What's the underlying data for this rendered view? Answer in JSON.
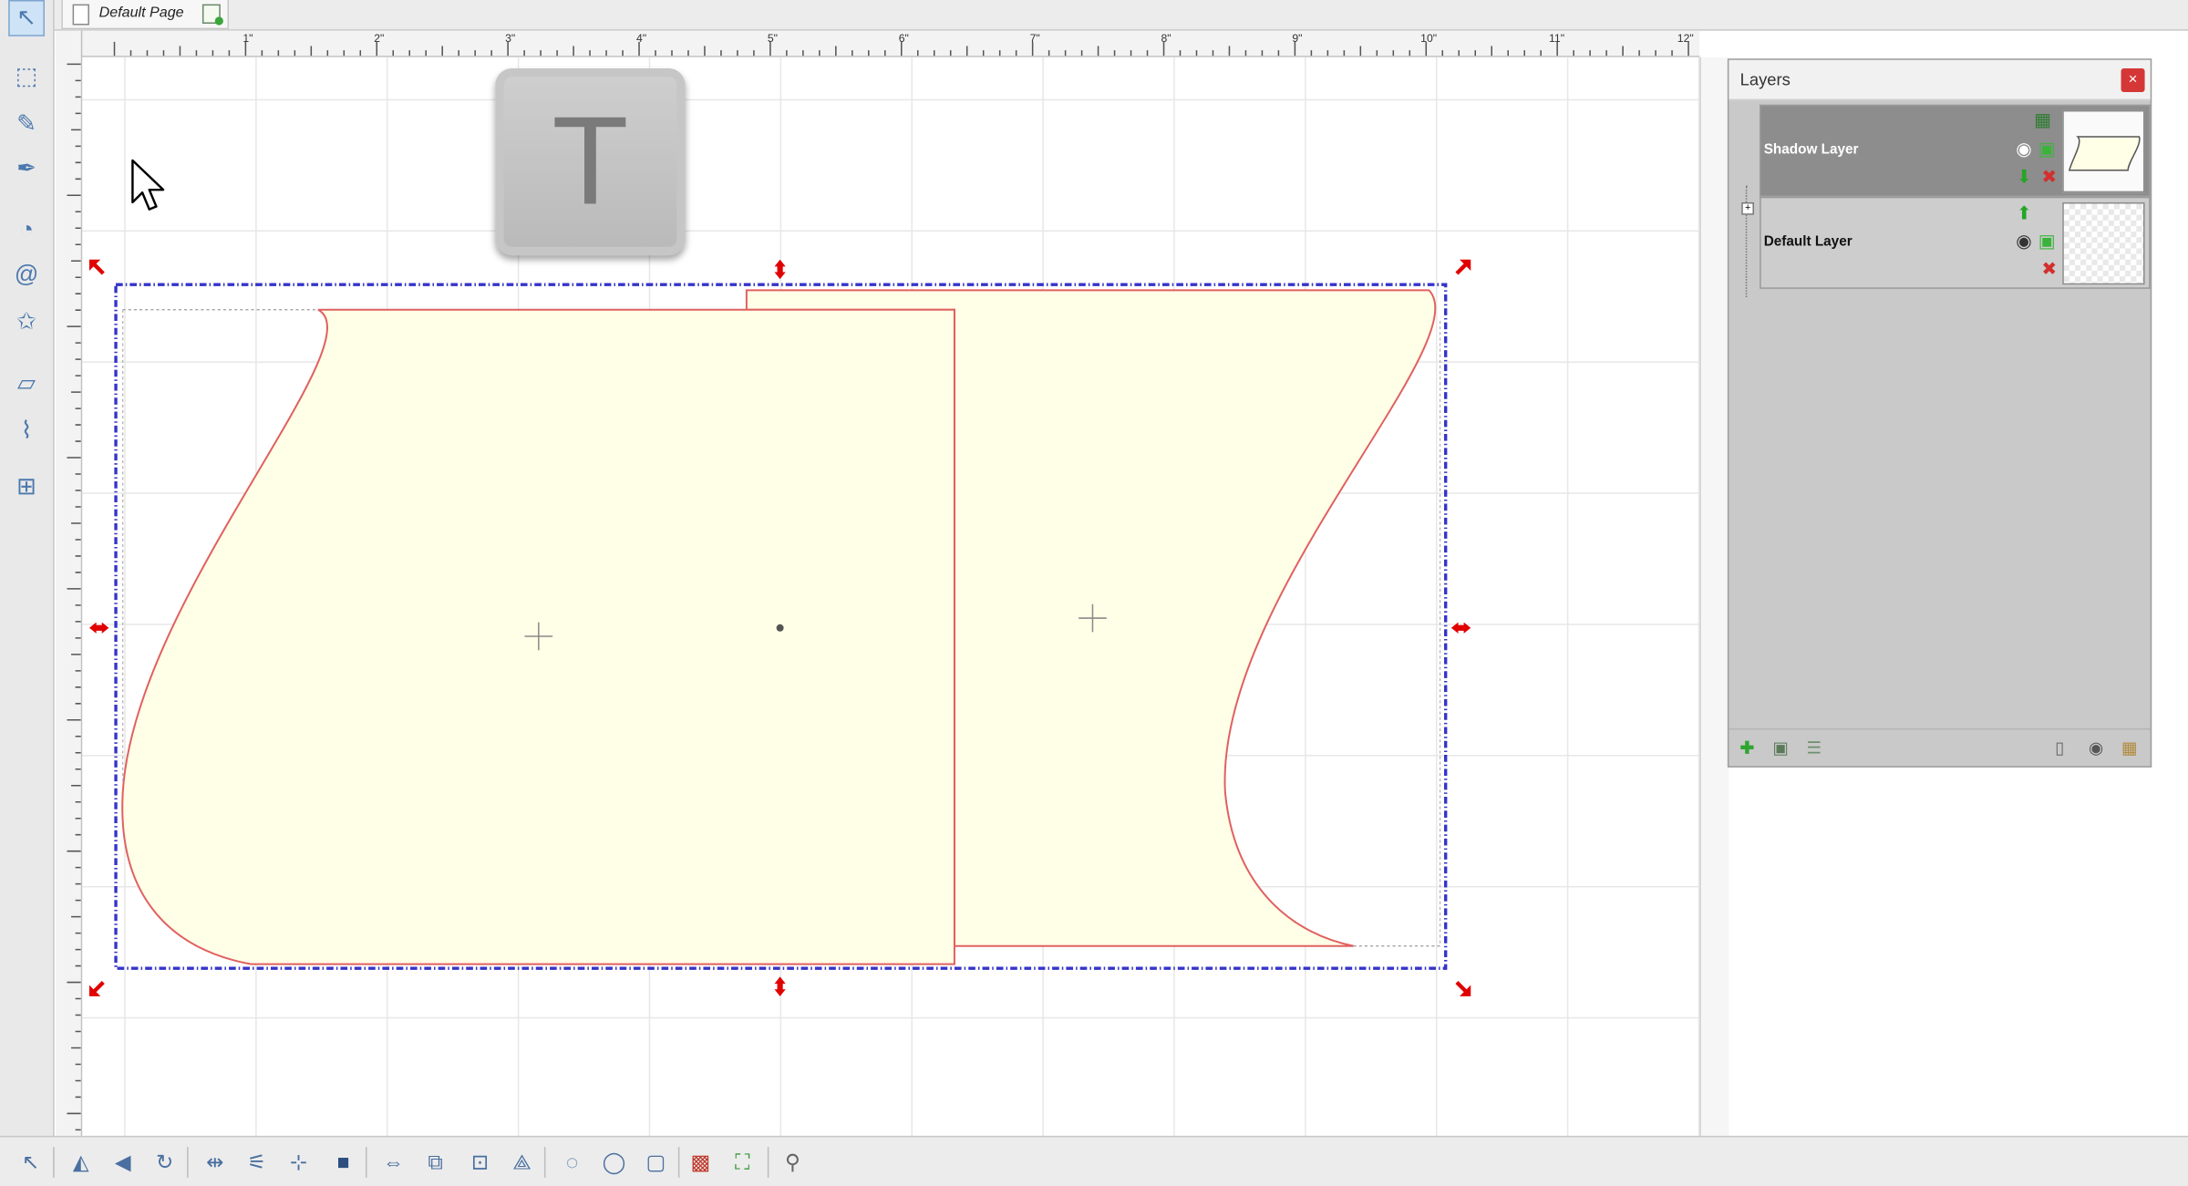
{
  "document": {
    "page_tab_label": "Default Page"
  },
  "ruler": {
    "h_labels": [
      "1\"",
      "2\"",
      "3\"",
      "4\"",
      "5\"",
      "6\"",
      "7\"",
      "8\"",
      "9\"",
      "10\"",
      "11\"",
      "12\""
    ]
  },
  "left_tools": [
    {
      "name": "select-arrow-icon",
      "glyph": "↖"
    },
    {
      "name": "node-edit-icon",
      "glyph": "⬚"
    },
    {
      "name": "pencil-icon",
      "glyph": "✎"
    },
    {
      "name": "pen-tool-icon",
      "glyph": "✒"
    },
    {
      "name": "shapes-icon",
      "glyph": "◔"
    },
    {
      "name": "spiral-icon",
      "glyph": "@"
    },
    {
      "name": "star-icon",
      "glyph": "✩"
    },
    {
      "name": "eraser-icon",
      "glyph": "▱"
    },
    {
      "name": "knife-icon",
      "glyph": "⌇"
    },
    {
      "name": "measure-icon",
      "glyph": "⊞"
    }
  ],
  "key_overlay": {
    "letter": "T"
  },
  "layers_panel": {
    "title": "Layers",
    "close_glyph": "×",
    "layers": [
      {
        "name": "Shadow Layer",
        "selected": true
      },
      {
        "name": "Default Layer",
        "selected": false
      }
    ]
  },
  "bottom_tools": [
    "select-arrow-icon",
    "flip-horizontal-icon",
    "flip-vertical-icon",
    "rotate-icon",
    "align-icon",
    "distribute-icon",
    "center-icon",
    "shadow-icon",
    "space-evenly-icon",
    "group-icon",
    "ungroup-icon",
    "weld-icon",
    "rotate-circle-icon",
    "speech-bubble-icon",
    "box-icon",
    "pattern-fill-icon",
    "frame-icon",
    "wand-icon"
  ],
  "colors": {
    "shape_fill": "#fffee6",
    "shape_stroke": "#e06060",
    "selection": "#3434c9",
    "handle": "#e00000"
  }
}
